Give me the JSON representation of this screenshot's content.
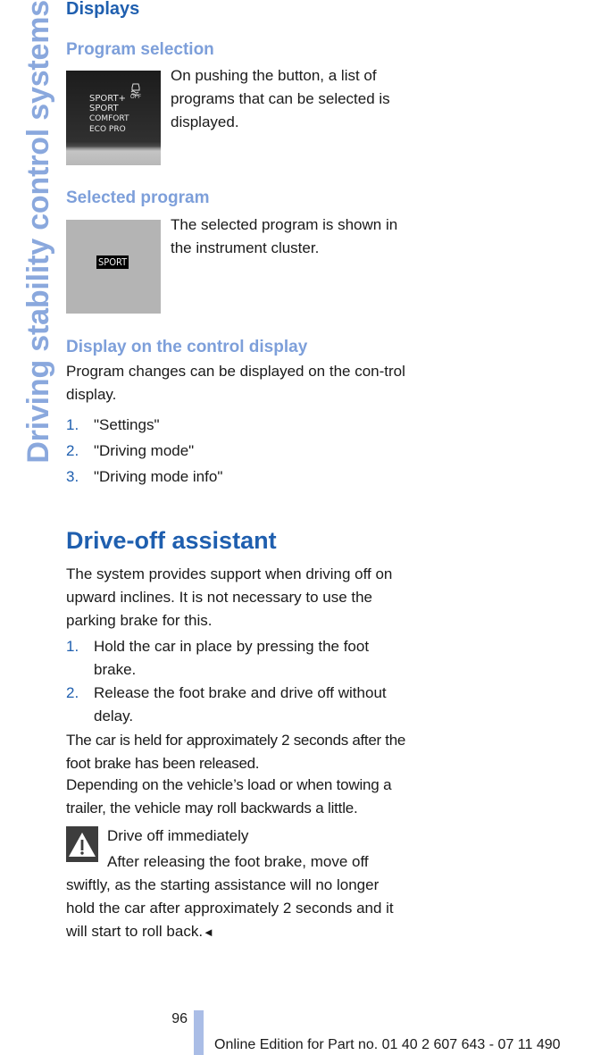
{
  "sidebar": {
    "chapter_title": "Driving stability control systems"
  },
  "sections": {
    "displays": {
      "title": "Displays",
      "program_selection": {
        "title": "Program selection",
        "text": "On pushing the button, a list of programs that can be selected is displayed.",
        "image": {
          "programs": [
            "SPORT+",
            "SPORT",
            "COMFORT",
            "ECO PRO"
          ],
          "icon": "dsc-off-icon",
          "icon_label": "OFF"
        }
      },
      "selected_program": {
        "title": "Selected program",
        "text": "The selected program is shown in the instrument cluster.",
        "image": {
          "badge": "SPORT"
        }
      },
      "control_display": {
        "title": "Display on the control display",
        "text": "Program changes can be displayed on the con-trol display.",
        "steps": [
          {
            "num": "1.",
            "text": "\"Settings\""
          },
          {
            "num": "2.",
            "text": "\"Driving mode\""
          },
          {
            "num": "3.",
            "text": "\"Driving mode info\""
          }
        ]
      }
    },
    "drive_off": {
      "title": "Drive-off assistant",
      "intro": "The system provides support when driving off on upward inclines. It is not necessary to use the parking brake for this.",
      "steps": [
        {
          "num": "1.",
          "text": "Hold the car in place by pressing the foot brake."
        },
        {
          "num": "2.",
          "text": "Release the foot brake and drive off without delay."
        }
      ],
      "para1": "The car is held for approximately 2 seconds after the foot brake has been released.",
      "para2": "Depending on the vehicle’s load or when towing a trailer, the vehicle may roll backwards a little.",
      "warning": {
        "icon": "warning-icon",
        "title": "Drive off immediately",
        "text": "After releasing the foot brake, move off swiftly, as the starting assistance will no longer hold the car after approximately 2 seconds and it will start to roll back.",
        "end_mark": "◄"
      }
    }
  },
  "footer": {
    "page_number": "96",
    "edition": "Online Edition for Part no. 01 40 2 607 643 - 07 11 490"
  },
  "colors": {
    "heading": "#1f5faf",
    "subheading": "#7d9fda",
    "sidebar": "#8aa8dd",
    "footer_bar": "#aabde6"
  }
}
